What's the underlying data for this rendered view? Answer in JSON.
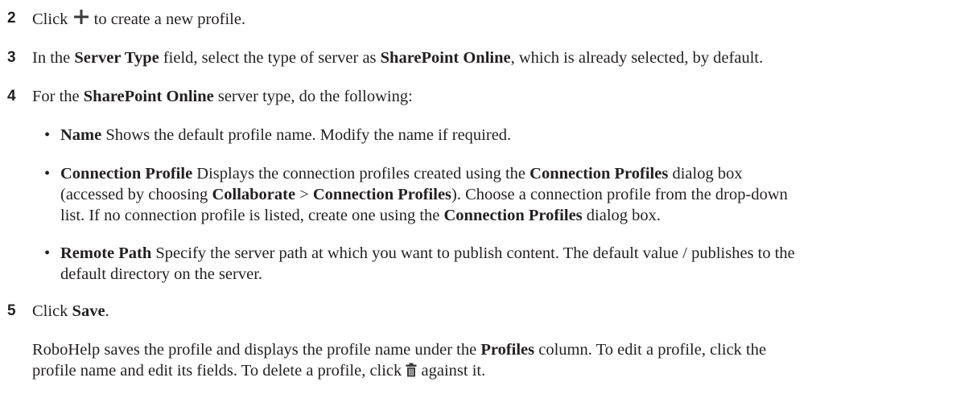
{
  "steps": {
    "s2": {
      "number": "2",
      "click": "Click",
      "text": "to create a new profile."
    },
    "s3": {
      "number": "3",
      "t1": "In the",
      "b1": "Server Type",
      "t2": "field, select the type of server as",
      "b2": "SharePoint Online",
      "t3": ", which is already selected, by default."
    },
    "s4": {
      "number": "4",
      "t1": "For the",
      "b1": "SharePoint Online",
      "t2": "server type, do the following:",
      "bullet_glyph": "•",
      "name_label": "Name",
      "name_text": "Shows the default profile name. Modify the name if required.",
      "conn_label": "Connection Profile",
      "conn_t1": "Displays the connection profiles created using the",
      "conn_b1": "Connection Profiles",
      "conn_t2": "dialog box",
      "conn_t3": "(accessed by choosing",
      "conn_b2": "Collaborate",
      "conn_sep": ">",
      "conn_b3": "Connection Profiles",
      "conn_t4": "). Choose a connection profile from the drop-down",
      "conn_t5": "list. If no connection profile is listed, create one using the",
      "conn_b4": "Connection Profiles",
      "conn_t6": "dialog box.",
      "remote_label": "Remote Path",
      "remote_t1": "Specify the server path at which you want to publish content. The default value / publishes to the",
      "remote_t2": "default directory on the server."
    },
    "s5": {
      "number": "5",
      "click": "Click",
      "save": "Save",
      "period": ".",
      "p1": "RoboHelp saves the profile and displays the profile name under the",
      "p_b1": "Profiles",
      "p2": "column. To edit a profile, click the",
      "p3": "profile name and edit its fields. To delete a profile, click",
      "p4": "against it."
    }
  },
  "icons": {
    "add": "plus-icon",
    "delete": "trash-icon"
  },
  "colors": {
    "text": "#231f20",
    "icon": "#3a3a3a"
  }
}
